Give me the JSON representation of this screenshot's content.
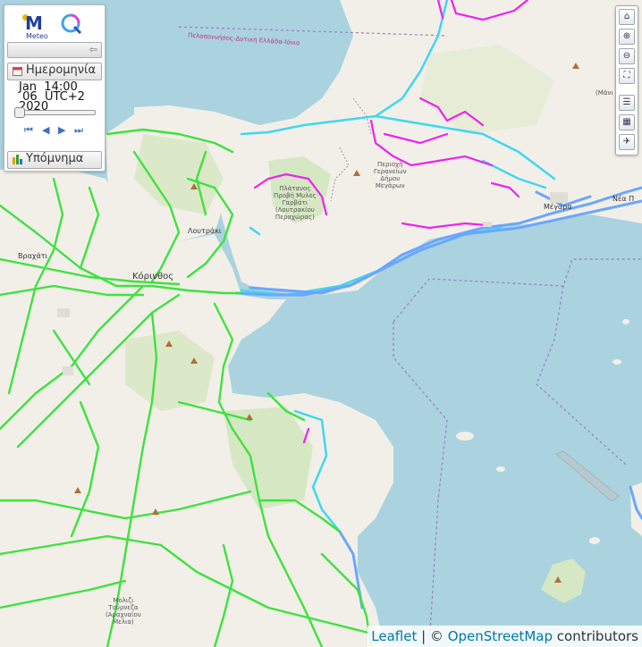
{
  "panel": {
    "logo_text": "Meteo",
    "date_label": "Ημερομηνία",
    "date_line1": "Jan  14:00",
    "date_line2": " 06  UTC+2",
    "date_line3": "2020",
    "legend_label": "Υπόμνημα"
  },
  "attribution": {
    "leaflet": "Leaflet",
    "separator": " | © ",
    "osm": "OpenStreetMap",
    "suffix": " contributors"
  },
  "map_labels": {
    "trail": "Πελοποννήσος-Δυτική Ελλάδα-Ιόνιο",
    "loutraki": "Λουτράκι",
    "korinthos": "Κόρινθος",
    "vrahati": "Βραχάτι",
    "megara": "Μέγαρα",
    "nea_peramos": "Νέα Π",
    "platanos": [
      "Πλάτανος",
      "Προβή Μυλος",
      "Γαρβάτι",
      "(Λουτρακίου",
      "Περαχώρας)"
    ],
    "gerania": [
      "Περιοχή",
      "Γερανείων",
      "Δήμου",
      "Μεγάρων"
    ],
    "mali": [
      "(Μάνι"
    ],
    "molizi": [
      "Μολιζι",
      "Τούρνεζα",
      "(Αραχναίου",
      "Μελια)"
    ]
  },
  "colors": {
    "sea": "#aad3df",
    "land": "#f2efe9",
    "forest": "#d6e7c4",
    "green_road": "#3ee23e",
    "magenta_road": "#ee22ee",
    "cyan_road": "#3fd7f0",
    "blue_road": "#6aa6ff"
  },
  "icons": [
    "home-icon",
    "zoom-in-icon",
    "zoom-out-icon",
    "fullscreen-icon",
    "layers-icon",
    "map-icon",
    "runner-icon",
    "calendar-icon",
    "legend-icon"
  ]
}
